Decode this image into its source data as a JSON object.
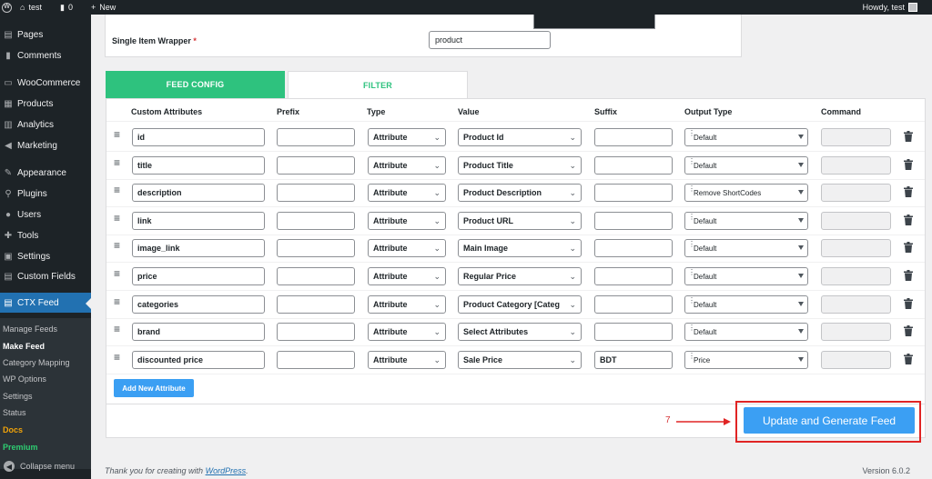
{
  "adminbar": {
    "site_name": "test",
    "comments_count": "0",
    "new_label": "New",
    "howdy": "Howdy, test"
  },
  "sidebar": {
    "items": [
      {
        "label": "Pages",
        "icon": "pages-icon"
      },
      {
        "label": "Comments",
        "icon": "comments-icon"
      },
      {
        "label": "WooCommerce",
        "icon": "woocommerce-icon"
      },
      {
        "label": "Products",
        "icon": "products-icon"
      },
      {
        "label": "Analytics",
        "icon": "analytics-icon"
      },
      {
        "label": "Marketing",
        "icon": "marketing-icon"
      },
      {
        "label": "Appearance",
        "icon": "appearance-icon"
      },
      {
        "label": "Plugins",
        "icon": "plugins-icon"
      },
      {
        "label": "Users",
        "icon": "users-icon"
      },
      {
        "label": "Tools",
        "icon": "tools-icon"
      },
      {
        "label": "Settings",
        "icon": "settings-icon"
      },
      {
        "label": "Custom Fields",
        "icon": "custom-fields-icon"
      },
      {
        "label": "CTX Feed",
        "icon": "ctx-feed-icon"
      }
    ],
    "submenu": [
      "Manage Feeds",
      "Make Feed",
      "Category Mapping",
      "WP Options",
      "Settings",
      "Status",
      "Docs",
      "Premium"
    ],
    "collapse_label": "Collapse menu"
  },
  "wrapper": {
    "label": "Single Item Wrapper",
    "required_mark": "*",
    "value": "product"
  },
  "tabs": {
    "config": "FEED CONFIG",
    "filter": "FILTER"
  },
  "table": {
    "headers": {
      "custom_attributes": "Custom Attributes",
      "prefix": "Prefix",
      "type": "Type",
      "value": "Value",
      "suffix": "Suffix",
      "output_type": "Output Type",
      "command": "Command"
    },
    "rows": [
      {
        "attribute": "id",
        "prefix": "",
        "type": "Attribute",
        "value": "Product Id",
        "suffix": "",
        "output": "Default"
      },
      {
        "attribute": "title",
        "prefix": "",
        "type": "Attribute",
        "value": "Product Title",
        "suffix": "",
        "output": "Default"
      },
      {
        "attribute": "description",
        "prefix": "",
        "type": "Attribute",
        "value": "Product Description",
        "suffix": "",
        "output": "Remove ShortCodes"
      },
      {
        "attribute": "link",
        "prefix": "",
        "type": "Attribute",
        "value": "Product URL",
        "suffix": "",
        "output": "Default"
      },
      {
        "attribute": "image_link",
        "prefix": "",
        "type": "Attribute",
        "value": "Main Image",
        "suffix": "",
        "output": "Default"
      },
      {
        "attribute": "price",
        "prefix": "",
        "type": "Attribute",
        "value": "Regular Price",
        "suffix": "",
        "output": "Default"
      },
      {
        "attribute": "categories",
        "prefix": "",
        "type": "Attribute",
        "value": "Product Category [Categ",
        "suffix": "",
        "output": "Default"
      },
      {
        "attribute": "brand",
        "prefix": "",
        "type": "Attribute",
        "value": "Select Attributes",
        "suffix": "",
        "output": "Default"
      },
      {
        "attribute": "discounted price",
        "prefix": "",
        "type": "Attribute",
        "value": "Sale Price",
        "suffix": "BDT",
        "output": "Price"
      }
    ]
  },
  "buttons": {
    "add_attribute": "Add New Attribute",
    "update_generate": "Update and Generate Feed"
  },
  "annotation": {
    "number": "7"
  },
  "footer": {
    "thanks_prefix": "Thank you for creating with",
    "wordpress_link": "WordPress",
    "thanks_suffix": ".",
    "version": "Version 6.0.2"
  },
  "colors": {
    "accent_green": "#2ec27e",
    "button_blue": "#3b9ff3",
    "active_menu": "#2271b1",
    "annotation_red": "#e02424"
  }
}
